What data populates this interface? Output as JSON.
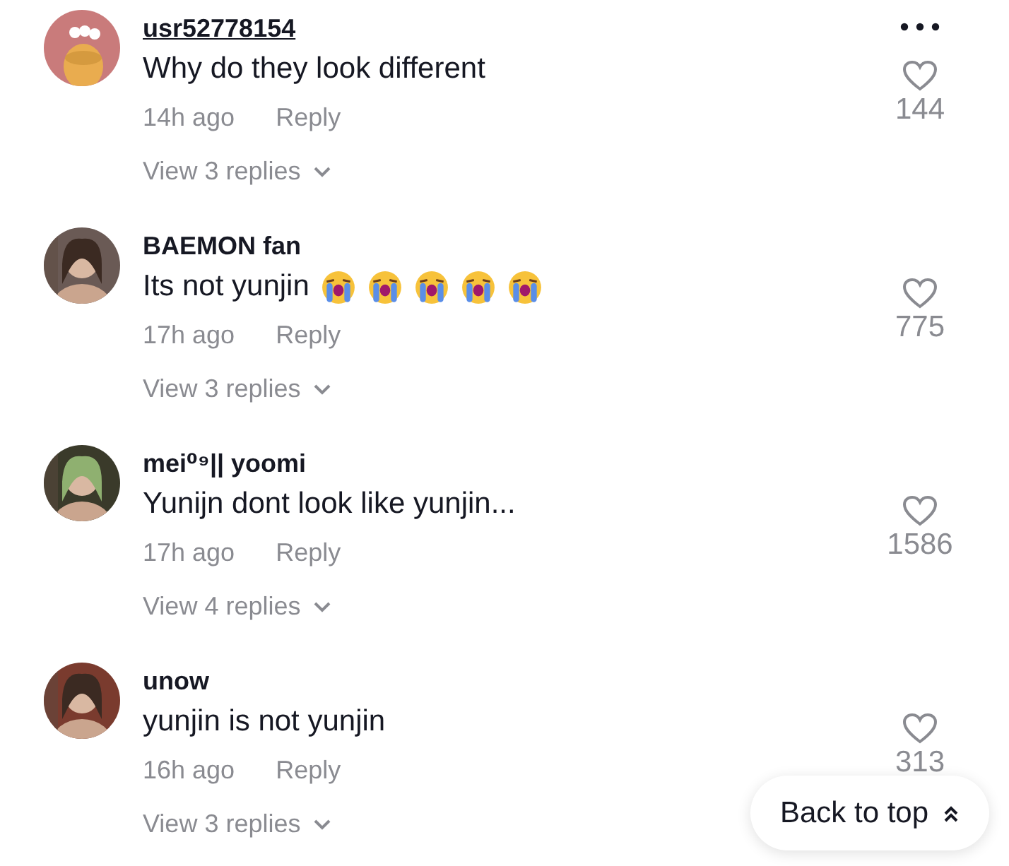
{
  "comments": [
    {
      "username": "usr52778154",
      "hovered": true,
      "text": "Why do they look different",
      "time": "14h ago",
      "reply": "Reply",
      "view_replies": "View 3 replies",
      "more_menu": true,
      "likes": "144"
    },
    {
      "username": "BAEMON fan",
      "hovered": false,
      "text": "Its not yunjin",
      "reactions": [
        {
          "kind": "crying-face"
        },
        {
          "kind": "crying-face"
        },
        {
          "kind": "crying-face"
        },
        {
          "kind": "crying-face"
        },
        {
          "kind": "crying-face"
        }
      ],
      "time": "17h ago",
      "reply": "Reply",
      "view_replies": "View 3 replies",
      "likes": "775"
    },
    {
      "username": "mei⁰⁹|| yoomi",
      "hovered": false,
      "text": "Yunijn dont look like yunjin...",
      "time": "17h ago",
      "reply": "Reply",
      "view_replies": "View 4 replies",
      "likes": "1586"
    },
    {
      "username": "unow",
      "hovered": false,
      "text": "yunjin is not yunjin",
      "time": "16h ago",
      "reply": "Reply",
      "view_replies": "View 3 replies",
      "likes": "313"
    }
  ],
  "back_to_top": {
    "label": "Back to top"
  }
}
